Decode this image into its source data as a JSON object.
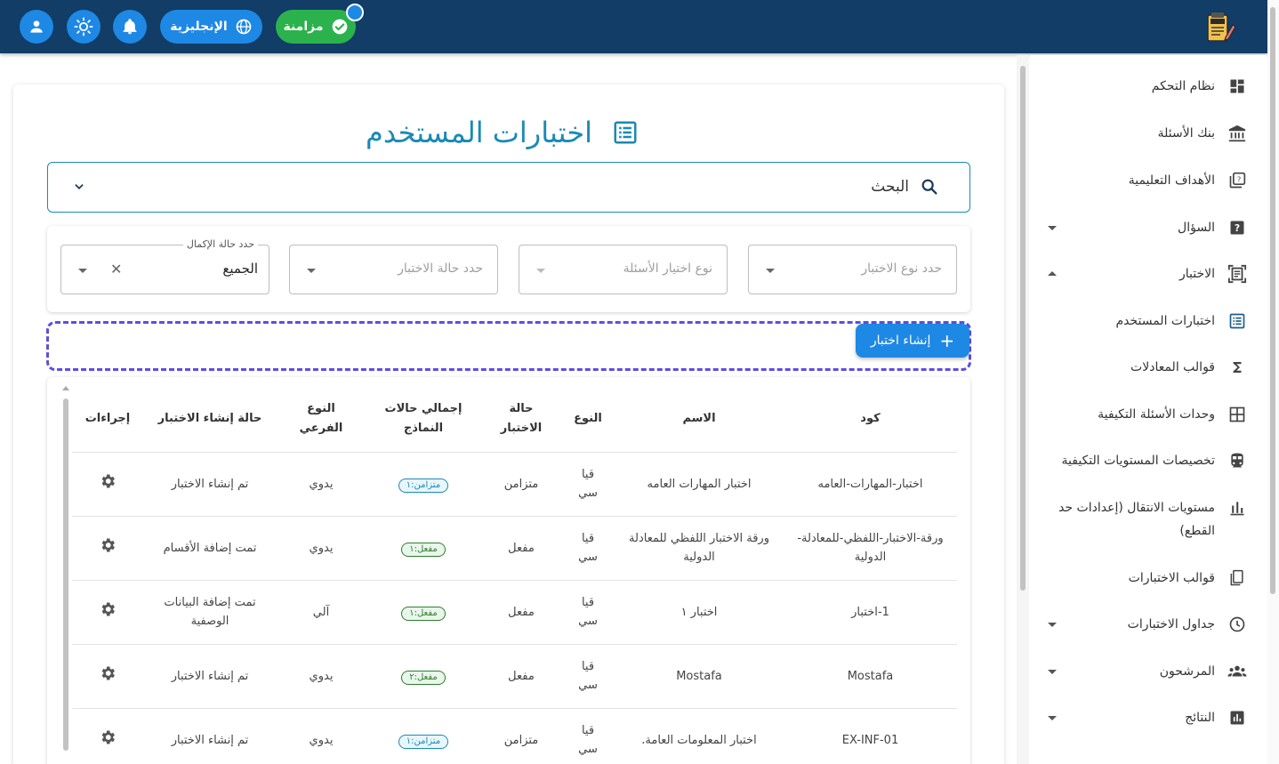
{
  "topbar": {
    "language_label": "الإنجليزية",
    "sync_label": "مزامنة",
    "icons": [
      "person-icon",
      "sun-icon",
      "bell-icon",
      "globe-icon",
      "check-circle-icon",
      "exam-logo-icon"
    ],
    "colors": {
      "bar": "#113d66",
      "accent": "#1e88e5",
      "sync": "#2bb24c"
    }
  },
  "sidebar": {
    "items": [
      {
        "label": "نظام التحكم",
        "icon": "dashboard-icon"
      },
      {
        "label": "بنك الأسئلة",
        "icon": "bank-icon"
      },
      {
        "label": "الأهداف التعليمية",
        "icon": "quiz-icon"
      },
      {
        "label": "السؤال",
        "icon": "help-box-icon"
      },
      {
        "label": "الاختبار",
        "icon": "document-scanner-icon"
      },
      {
        "label": "اختبارات المستخدم",
        "icon": "list-alt-icon"
      },
      {
        "label": "قوالب المعادلات",
        "icon": "sigma-icon"
      },
      {
        "label": "وحدات الأسئلة التكيفية",
        "icon": "grid-icon"
      },
      {
        "label": "تخصيصات المستويات التكيفية",
        "icon": "train-icon"
      },
      {
        "label": "مستويات الانتقال (إعدادات حد القطع)",
        "icon": "bar-chart-icon"
      },
      {
        "label": "قوالب الاختبارات",
        "icon": "template-icon"
      },
      {
        "label": "جداول الاختبارات",
        "icon": "clock-icon"
      },
      {
        "label": "المرشحون",
        "icon": "groups-icon"
      },
      {
        "label": "النتائج",
        "icon": "chart-box-icon"
      }
    ]
  },
  "main": {
    "title": "اختبارات المستخدم",
    "search_label": "البحث",
    "filters": {
      "test_type_placeholder": "حدد نوع الاختبار",
      "question_type_placeholder": "نوع اختيار الأسئلة",
      "test_status_placeholder": "حدد حالة الاختبار",
      "completion_label": "حدد حالة الإكمال",
      "completion_value": "الجميع"
    },
    "create_button": "إنشاء اختبار",
    "table": {
      "headers": [
        "كود",
        "الاسم",
        "النوع",
        "حالة الاختبار",
        "إجمالي حالات النماذج",
        "النوع الفرعي",
        "حالة إنشاء الاختبار",
        "إجراءات"
      ],
      "rows": [
        {
          "code": "اختبار-المهارات-العامه",
          "name": "اختبار المهارات العامه",
          "type": "قيا سي",
          "status": "متزامن",
          "badge": "متزامن:١",
          "badge_kind": "sync",
          "subtype": "يدوي",
          "creation": "تم إنشاء الاختبار"
        },
        {
          "code": "ورقة-الاختبار-اللفظي-للمعادلة-الدولية",
          "name": "ورقة الاختبار اللفظي للمعادلة الدولية",
          "type": "قيا سي",
          "status": "مفعل",
          "badge": "مفعل:١",
          "badge_kind": "on",
          "subtype": "يدوي",
          "creation": "تمت إضافة الأقسام"
        },
        {
          "code": "1-اختبار",
          "name": "اختبار ١",
          "type": "قيا سي",
          "status": "مفعل",
          "badge": "مفعل:١",
          "badge_kind": "on",
          "subtype": "آلي",
          "creation": "تمت إضافة البيانات الوصفية"
        },
        {
          "code": "Mostafa",
          "name": "Mostafa",
          "type": "قيا سي",
          "status": "مفعل",
          "badge": "مفعل:٢",
          "badge_kind": "on",
          "subtype": "يدوي",
          "creation": "تم إنشاء الاختبار"
        },
        {
          "code": "EX-INF-01",
          "name": "اختبار المعلومات العامة.",
          "type": "قيا سي",
          "status": "متزامن",
          "badge": "متزامن:١",
          "badge_kind": "sync",
          "subtype": "يدوي",
          "creation": "تم إنشاء الاختبار"
        }
      ]
    }
  }
}
